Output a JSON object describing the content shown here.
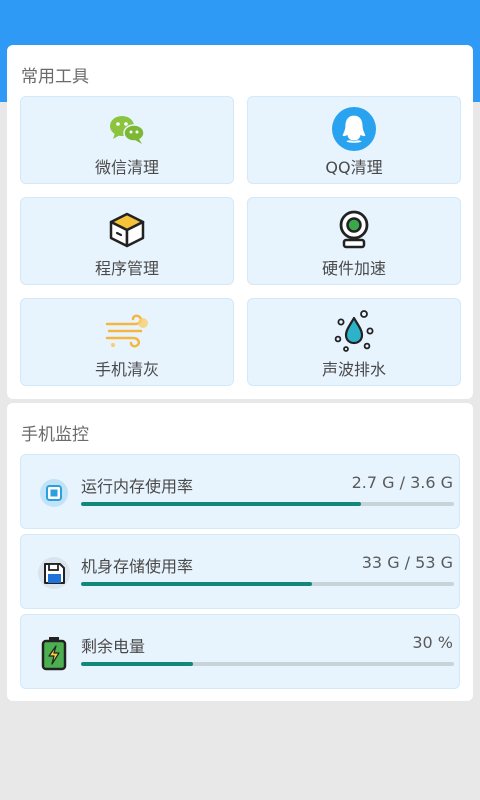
{
  "colors": {
    "header_blue": "#2f9af5",
    "tile_bg": "#e8f4fd",
    "progress_fill": "#13877a",
    "progress_track": "#c9d3da"
  },
  "tools_section": {
    "title": "常用工具",
    "items": [
      {
        "label": "微信清理",
        "icon": "wechat-icon"
      },
      {
        "label": "QQ清理",
        "icon": "qq-penguin-icon"
      },
      {
        "label": "程序管理",
        "icon": "cube-box-icon"
      },
      {
        "label": "硬件加速",
        "icon": "webcam-icon"
      },
      {
        "label": "手机清灰",
        "icon": "wind-dust-icon"
      },
      {
        "label": "声波排水",
        "icon": "water-drop-icon"
      }
    ]
  },
  "monitor_section": {
    "title": "手机监控",
    "items": [
      {
        "label": "运行内存使用率",
        "value": "2.7 G / 3.6 G",
        "icon": "chip-icon",
        "fraction": 0.75
      },
      {
        "label": "机身存储使用率",
        "value": "33 G / 53 G",
        "icon": "floppy-disk-icon",
        "fraction": 0.62
      },
      {
        "label": "剩余电量",
        "value": "30 %",
        "icon": "battery-icon",
        "fraction": 0.3
      }
    ]
  }
}
